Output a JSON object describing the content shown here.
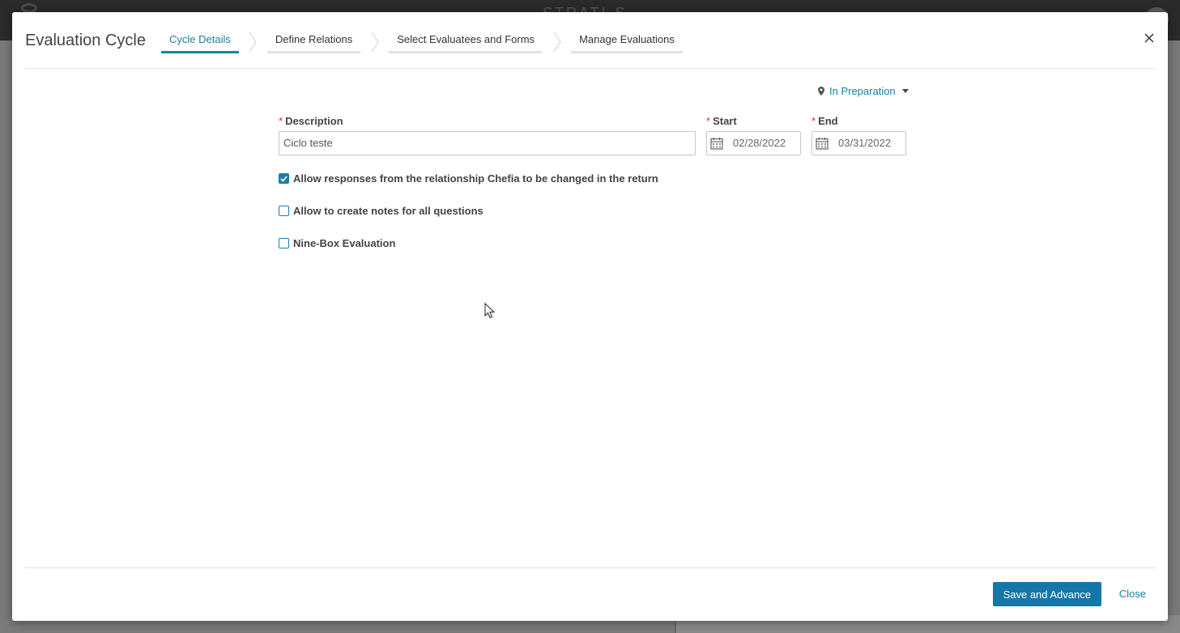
{
  "background": {
    "brand": "STRATI-S"
  },
  "modal": {
    "title": "Evaluation Cycle",
    "steps": [
      {
        "label": "Cycle Details",
        "active": true
      },
      {
        "label": "Define Relations",
        "active": false
      },
      {
        "label": "Select Evaluatees and Forms",
        "active": false
      },
      {
        "label": "Manage Evaluations",
        "active": false
      }
    ],
    "status": "In Preparation",
    "form": {
      "required_mark": "*",
      "description_label": "Description",
      "description_value": "Ciclo teste",
      "start_label": "Start",
      "start_value": "02/28/2022",
      "end_label": "End",
      "end_value": "03/31/2022",
      "checkboxes": [
        {
          "label": "Allow responses from the relationship Chefia to be changed in the return",
          "checked": true
        },
        {
          "label": "Allow to create notes for all questions",
          "checked": false
        },
        {
          "label": "Nine-Box Evaluation",
          "checked": false
        }
      ]
    },
    "footer": {
      "save_label": "Save and Advance",
      "close_label": "Close"
    }
  },
  "colors": {
    "accent": "#1a7fa8",
    "primary_button": "#1577a8",
    "required": "#c0392b"
  }
}
